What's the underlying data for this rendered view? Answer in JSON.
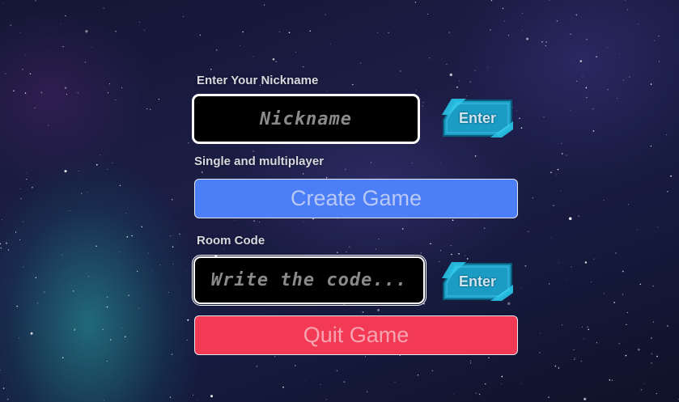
{
  "nickname_section": {
    "label": "Enter Your Nickname",
    "placeholder": "Nickname",
    "enter_label": "Enter"
  },
  "mode_section": {
    "label": "Single and multiplayer",
    "create_label": "Create Game"
  },
  "room_section": {
    "label": "Room Code",
    "placeholder": "Write the code...",
    "enter_label": "Enter"
  },
  "quit_label": "Quit Game",
  "colors": {
    "create_button": "#4b7ef7",
    "quit_button": "#f23a55",
    "enter_button": "#1a9cc4"
  }
}
